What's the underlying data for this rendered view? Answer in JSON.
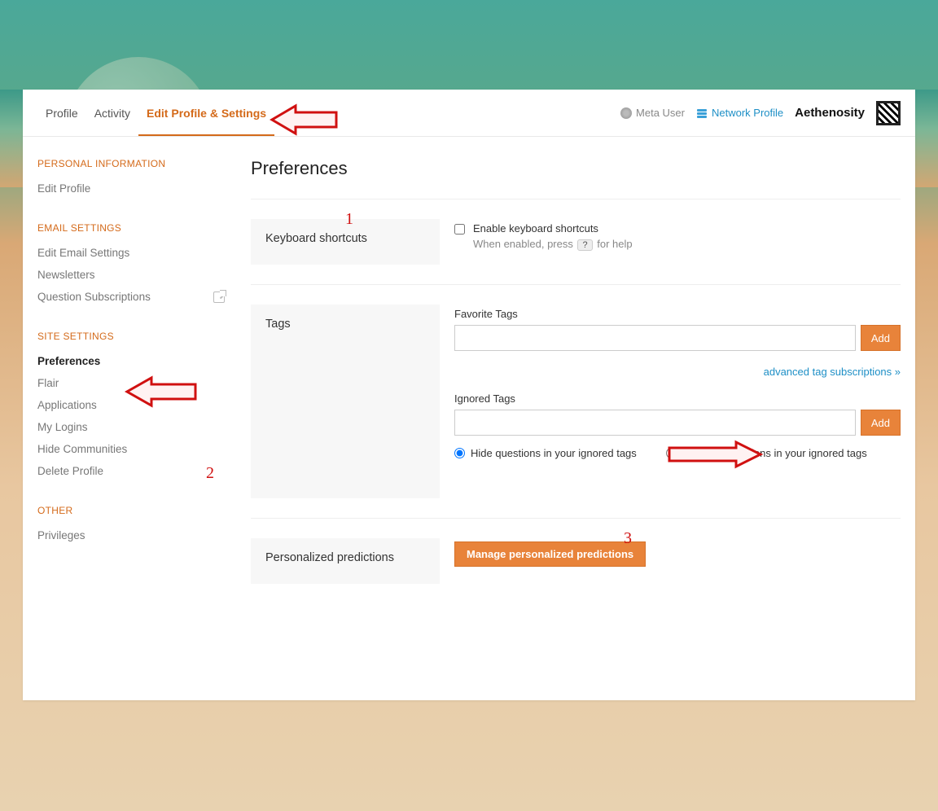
{
  "tabs": {
    "profile": "Profile",
    "activity": "Activity",
    "edit": "Edit Profile & Settings"
  },
  "topright": {
    "meta": "Meta User",
    "network": "Network Profile",
    "username": "Aethenosity"
  },
  "sidebar": {
    "personal": {
      "heading": "PERSONAL INFORMATION",
      "items": [
        "Edit Profile"
      ]
    },
    "email": {
      "heading": "EMAIL SETTINGS",
      "items": [
        "Edit Email Settings",
        "Newsletters",
        "Question Subscriptions"
      ]
    },
    "site": {
      "heading": "SITE SETTINGS",
      "items": [
        "Preferences",
        "Flair",
        "Applications",
        "My Logins",
        "Hide Communities",
        "Delete Profile"
      ]
    },
    "other": {
      "heading": "OTHER",
      "items": [
        "Privileges"
      ]
    }
  },
  "page": {
    "title": "Preferences",
    "kb": {
      "section": "Keyboard shortcuts",
      "enable": "Enable keyboard shortcuts",
      "help_pre": "When enabled, press",
      "help_key": "?",
      "help_post": "for help"
    },
    "tags": {
      "section": "Tags",
      "fav_label": "Favorite Tags",
      "ign_label": "Ignored Tags",
      "add": "Add",
      "advanced": "advanced tag subscriptions »",
      "radio_hide": "Hide questions in your ignored tags",
      "radio_gray": "Gray out questions in your ignored tags"
    },
    "pred": {
      "section": "Personalized predictions",
      "button": "Manage personalized predictions"
    }
  },
  "annot": {
    "n1": "1",
    "n2": "2",
    "n3": "3"
  }
}
